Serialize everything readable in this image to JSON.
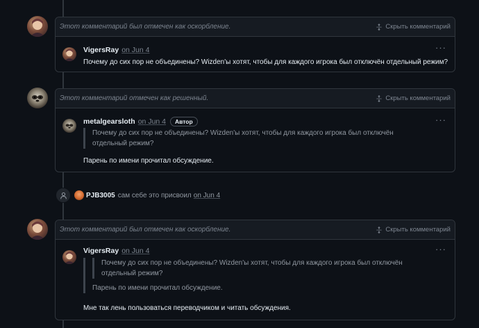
{
  "threads": [
    {
      "hidden_reason": "Этот комментарий был отмечен как оскорбление.",
      "show_label": "Скрыть комментарий",
      "comment": {
        "author": "VigersRay",
        "on": "on",
        "date": "Jun 4",
        "text": "Почему до сих пор не объединены? Wizden'ы хотят, чтобы для каждого игрока был отключён отдельный режим?"
      }
    },
    {
      "hidden_reason": "Этот комментарий отмечен как решенный.",
      "show_label": "Скрыть комментарий",
      "comment": {
        "author": "metalgearsloth",
        "on": "on",
        "date": "Jun 4",
        "badge": "Автор",
        "quote": "Почему до сих пор не объединены? Wizden'ы хотят, чтобы для каждого игрока был отключён отдельный режим?",
        "text": "Парень по имени прочитал обсуждение."
      }
    },
    {
      "hidden_reason": "Этот комментарий был отмечен как оскорбление.",
      "show_label": "Скрыть комментарий",
      "comment": {
        "author": "VigersRay",
        "on": "on",
        "date": "Jun 4",
        "quote1": "Почему до сих пор не объединены? Wizden'ы хотят, чтобы для каждого игрока был отключён отдельный режим?",
        "quote2": "Парень по имени прочитал обсуждение.",
        "text": "Мне так лень пользоваться переводчиком и читать обсуждения."
      }
    }
  ],
  "event": {
    "user": "PJB3005",
    "action": "сам себе это присвоил",
    "on": "on",
    "date": "Jun 4"
  },
  "colors": {
    "background": "#0d1117",
    "border": "#30363d",
    "header_bg": "#161b22",
    "muted_text": "#7d8590"
  },
  "icons": [
    "unfold-icon",
    "kebab-horizontal-icon",
    "person-icon"
  ]
}
